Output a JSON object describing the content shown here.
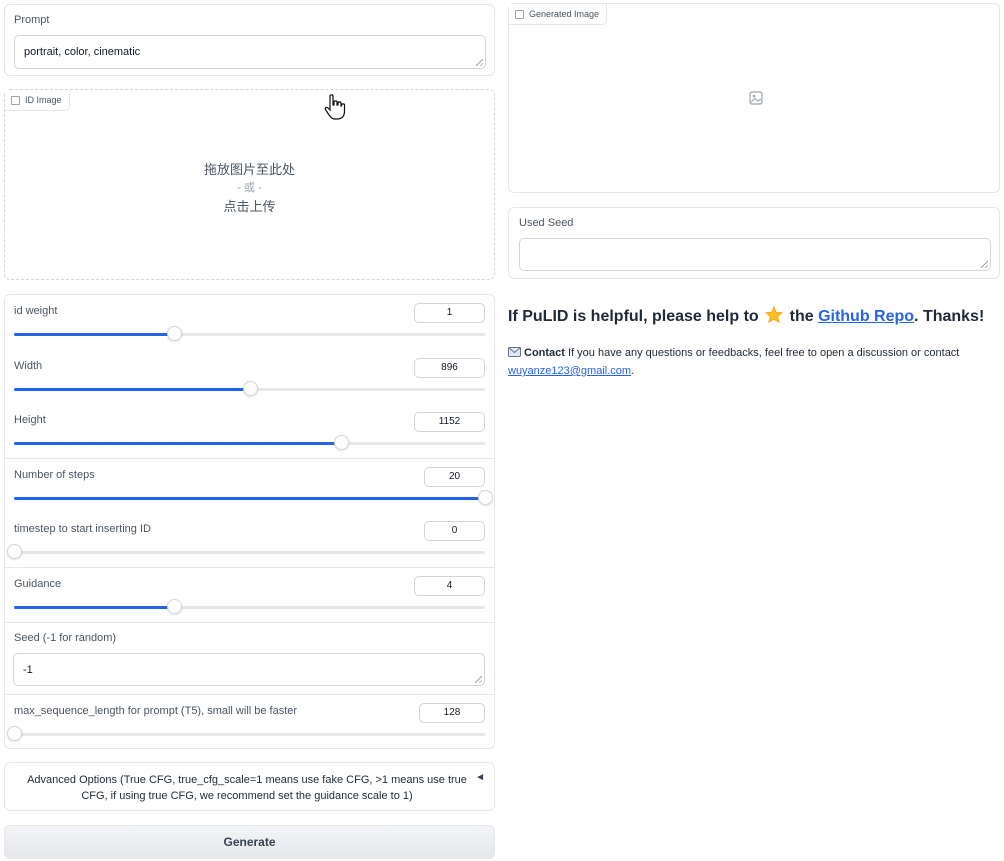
{
  "prompt": {
    "label": "Prompt",
    "value": "portrait, color, cinematic"
  },
  "id_image": {
    "label": "ID Image",
    "drop_text": "拖放图片至此处",
    "or_text": "- 或 -",
    "upload_text": "点击上传"
  },
  "sliders": [
    {
      "label": "id weight",
      "value": "1",
      "fraction": 0.34
    },
    {
      "label": "Width",
      "value": "896",
      "fraction": 0.5
    },
    {
      "label": "Height",
      "value": "1152",
      "fraction": 0.695
    },
    {
      "label": "Number of steps",
      "value": "20",
      "fraction": 1.0
    },
    {
      "label": "timestep to start inserting ID",
      "value": "0",
      "fraction": 0.0
    },
    {
      "label": "Guidance",
      "value": "4",
      "fraction": 0.34
    }
  ],
  "seed": {
    "label": "Seed (-1 for random)",
    "value": "-1"
  },
  "max_seq": {
    "label": "max_sequence_length for prompt (T5), small will be faster",
    "value": "128",
    "fraction": 0.0
  },
  "advanced": {
    "label": "Advanced Options (True CFG, true_cfg_scale=1 means use fake CFG, >1 means use true CFG, if using true CFG, we recommend set the guidance scale to 1)",
    "arrow": "◄"
  },
  "generate": {
    "label": "Generate"
  },
  "generated_image": {
    "label": "Generated Image"
  },
  "used_seed": {
    "label": "Used Seed",
    "value": ""
  },
  "info": {
    "heading_prefix": "If PuLID is helpful, please help to",
    "heading_mid": "the",
    "heading_link": "Github Repo",
    "heading_suffix": ". Thanks!",
    "contact_label": "Contact",
    "contact_text": "If you have any questions or feedbacks, feel free to open a discussion or contact",
    "email": "wuyanze123@gmail.com",
    "email_suffix": "."
  }
}
